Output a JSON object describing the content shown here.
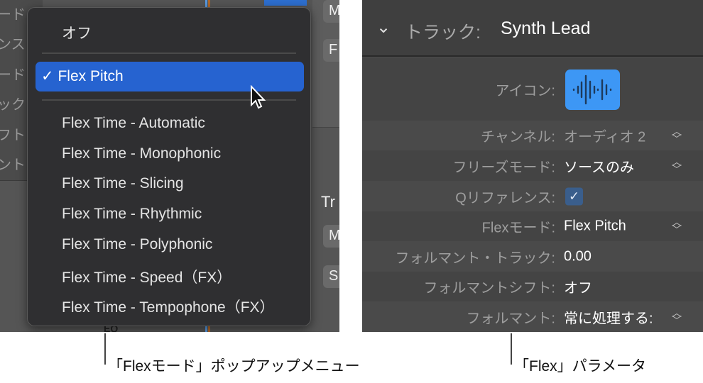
{
  "popup_menu": {
    "background_labels": [
      "ード",
      "ンス",
      "ード",
      "ック",
      "フト",
      "ント"
    ],
    "background_buttons": [
      "M",
      "F",
      "Tr",
      "M",
      "S"
    ],
    "background_footer": "EQ",
    "items": [
      {
        "label": "オフ",
        "selected": false
      },
      {
        "label": "Flex Pitch",
        "selected": true,
        "checkmark": "✓"
      },
      {
        "label": "Flex Time - Automatic"
      },
      {
        "label": "Flex Time - Monophonic"
      },
      {
        "label": "Flex Time - Slicing"
      },
      {
        "label": "Flex Time - Rhythmic"
      },
      {
        "label": "Flex Time - Polyphonic"
      },
      {
        "label": "Flex Time - Speed（FX）"
      },
      {
        "label": "Flex Time - Tempophone（FX）"
      }
    ],
    "highlight_color": "#2663d0"
  },
  "inspector": {
    "header": {
      "prefix": "トラック:",
      "track_name": "Synth Lead"
    },
    "rows": [
      {
        "label": "アイコン:",
        "icon": "waveform-icon"
      },
      {
        "label": "チャンネル:",
        "value": "オーディオ 2"
      },
      {
        "label": "フリーズモード:",
        "value": "ソースのみ"
      },
      {
        "label": "Qリファレンス:",
        "checked": true
      },
      {
        "label": "Flexモード:",
        "value": "Flex Pitch"
      },
      {
        "label": "フォルマント・トラック:",
        "value": "0.00"
      },
      {
        "label": "フォルマントシフト:",
        "value": "オフ"
      },
      {
        "label": "フォルマント:",
        "value": "常に処理する:"
      }
    ],
    "icon_color": "#3d97f5"
  },
  "captions": {
    "left": "「Flexモード」ポップアップメニュー",
    "right": "「Flex」パラメータ"
  }
}
